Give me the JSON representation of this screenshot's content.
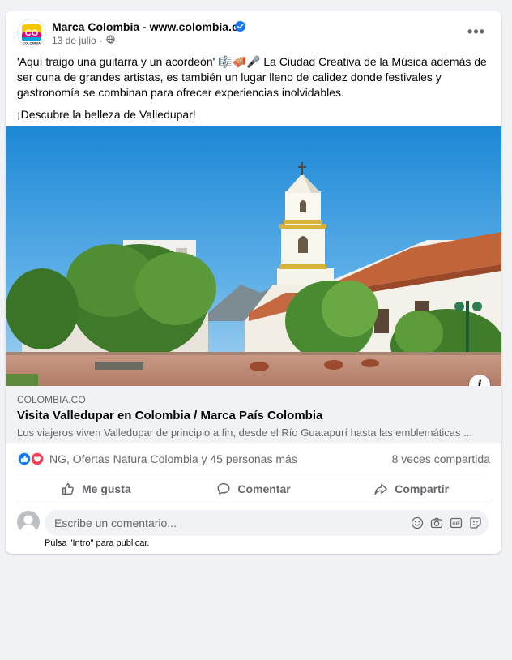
{
  "post": {
    "page_name": "Marca Colombia - www.colombia.co",
    "date": "13 de julio",
    "date_separator": "·",
    "text_1": "'Aquí traigo una guitarra y un acordeón' 🎼🪗🎤 La Ciudad Creativa de la Música además de ser cuna de grandes artistas, es también un lugar lleno de calidez donde festivales y gastronomía se combinan para ofrecer experiencias inolvidables.",
    "text_2": "¡Descubre la belleza de Valledupar!",
    "more_label": "•••"
  },
  "link": {
    "domain": "COLOMBIA.CO",
    "title": "Visita Valledupar en Colombia / Marca País Colombia",
    "description": "Los viajeros viven Valledupar de principio a fin, desde el Río Guatapurí hasta las emblemáticas ...",
    "info_label": "i"
  },
  "stats": {
    "reactions_text": "NG, Ofertas Natura Colombia y 45 personas más",
    "shares_text": "8 veces compartida"
  },
  "actions": {
    "like": "Me gusta",
    "comment": "Comentar",
    "share": "Compartir"
  },
  "comment": {
    "placeholder": "Escribe un comentario...",
    "hint": "Pulsa \"Intro\" para publicar."
  },
  "logo": {
    "text": "CO",
    "subtext": "COLOMBIA"
  },
  "colors": {
    "accent": "#1877f2",
    "love": "#f33e58",
    "text_secondary": "#65676b"
  }
}
